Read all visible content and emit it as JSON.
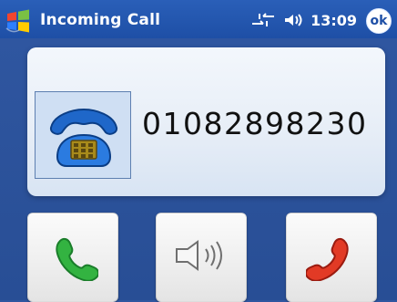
{
  "titlebar": {
    "title": "Incoming Call",
    "time": "13:09",
    "ok_label": "ok"
  },
  "call": {
    "number": "01082898230"
  },
  "icons": {
    "start": "windows-start-icon",
    "data": "data-arrows-icon",
    "volume": "speaker-volume-icon",
    "contact": "desk-phone-icon",
    "accept": "green-phone-icon",
    "speaker": "speaker-icon",
    "reject": "red-phone-icon"
  },
  "colors": {
    "titlebar": "#1e4fa6",
    "background": "#2f56a0",
    "accept": "#33b341",
    "reject": "#e23a25"
  }
}
